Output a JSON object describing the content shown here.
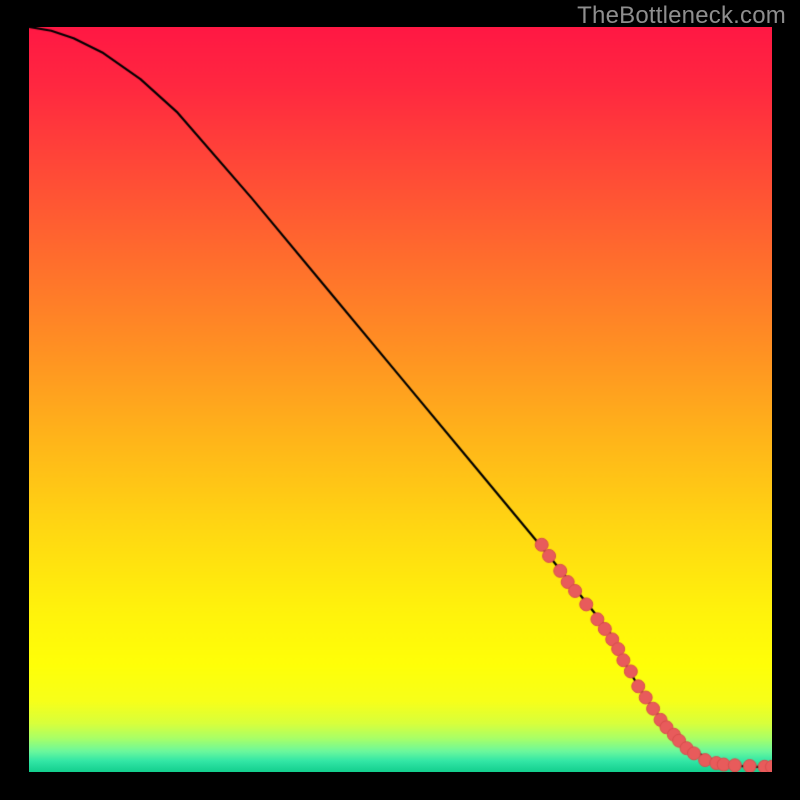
{
  "brand": {
    "watermark": "TheBottleneck.com"
  },
  "colors": {
    "curve": "#000000",
    "point_fill": "#e85b5b",
    "point_stroke": "#d84d4d"
  },
  "gradient_stops": [
    {
      "pos": 0.0,
      "color": "#ff1844"
    },
    {
      "pos": 0.08,
      "color": "#ff2840"
    },
    {
      "pos": 0.18,
      "color": "#ff4638"
    },
    {
      "pos": 0.3,
      "color": "#ff6a2e"
    },
    {
      "pos": 0.42,
      "color": "#ff8d24"
    },
    {
      "pos": 0.55,
      "color": "#ffb41a"
    },
    {
      "pos": 0.68,
      "color": "#ffd912"
    },
    {
      "pos": 0.78,
      "color": "#fff20c"
    },
    {
      "pos": 0.855,
      "color": "#ffff08"
    },
    {
      "pos": 0.905,
      "color": "#f7ff1a"
    },
    {
      "pos": 0.935,
      "color": "#d8ff3c"
    },
    {
      "pos": 0.955,
      "color": "#a8ff68"
    },
    {
      "pos": 0.972,
      "color": "#6cf89c"
    },
    {
      "pos": 0.985,
      "color": "#33e7a6"
    },
    {
      "pos": 1.0,
      "color": "#13cf8e"
    }
  ],
  "chart_data": {
    "type": "line",
    "title": "",
    "xlabel": "",
    "ylabel": "",
    "xlim": [
      0,
      100
    ],
    "ylim": [
      0,
      100
    ],
    "series": [
      {
        "name": "bottleneck-curve",
        "x": [
          0,
          3,
          6,
          10,
          15,
          20,
          30,
          40,
          50,
          60,
          70,
          74,
          78,
          80,
          82,
          84,
          86,
          88,
          90,
          92,
          94,
          96,
          98,
          100
        ],
        "y": [
          100,
          99.5,
          98.5,
          96.5,
          93,
          88.5,
          77,
          65,
          53,
          41,
          29,
          24,
          19,
          15,
          11.5,
          8.5,
          6,
          4,
          2.5,
          1.6,
          1.0,
          0.8,
          0.7,
          0.7
        ]
      }
    ],
    "scatter": {
      "name": "highlight-points",
      "points": [
        {
          "x": 69.0,
          "y": 30.5
        },
        {
          "x": 70.0,
          "y": 29.0
        },
        {
          "x": 71.5,
          "y": 27.0
        },
        {
          "x": 72.5,
          "y": 25.5
        },
        {
          "x": 73.5,
          "y": 24.3
        },
        {
          "x": 75.0,
          "y": 22.5
        },
        {
          "x": 76.5,
          "y": 20.5
        },
        {
          "x": 77.5,
          "y": 19.2
        },
        {
          "x": 78.5,
          "y": 17.8
        },
        {
          "x": 79.3,
          "y": 16.5
        },
        {
          "x": 80.0,
          "y": 15.0
        },
        {
          "x": 81.0,
          "y": 13.5
        },
        {
          "x": 82.0,
          "y": 11.5
        },
        {
          "x": 83.0,
          "y": 10.0
        },
        {
          "x": 84.0,
          "y": 8.5
        },
        {
          "x": 85.0,
          "y": 7.0
        },
        {
          "x": 85.8,
          "y": 6.0
        },
        {
          "x": 86.8,
          "y": 5.0
        },
        {
          "x": 87.5,
          "y": 4.2
        },
        {
          "x": 88.5,
          "y": 3.2
        },
        {
          "x": 89.5,
          "y": 2.5
        },
        {
          "x": 91.0,
          "y": 1.6
        },
        {
          "x": 92.5,
          "y": 1.2
        },
        {
          "x": 93.5,
          "y": 1.0
        },
        {
          "x": 95.0,
          "y": 0.9
        },
        {
          "x": 97.0,
          "y": 0.8
        },
        {
          "x": 99.0,
          "y": 0.7
        },
        {
          "x": 100.0,
          "y": 0.7
        }
      ]
    }
  }
}
